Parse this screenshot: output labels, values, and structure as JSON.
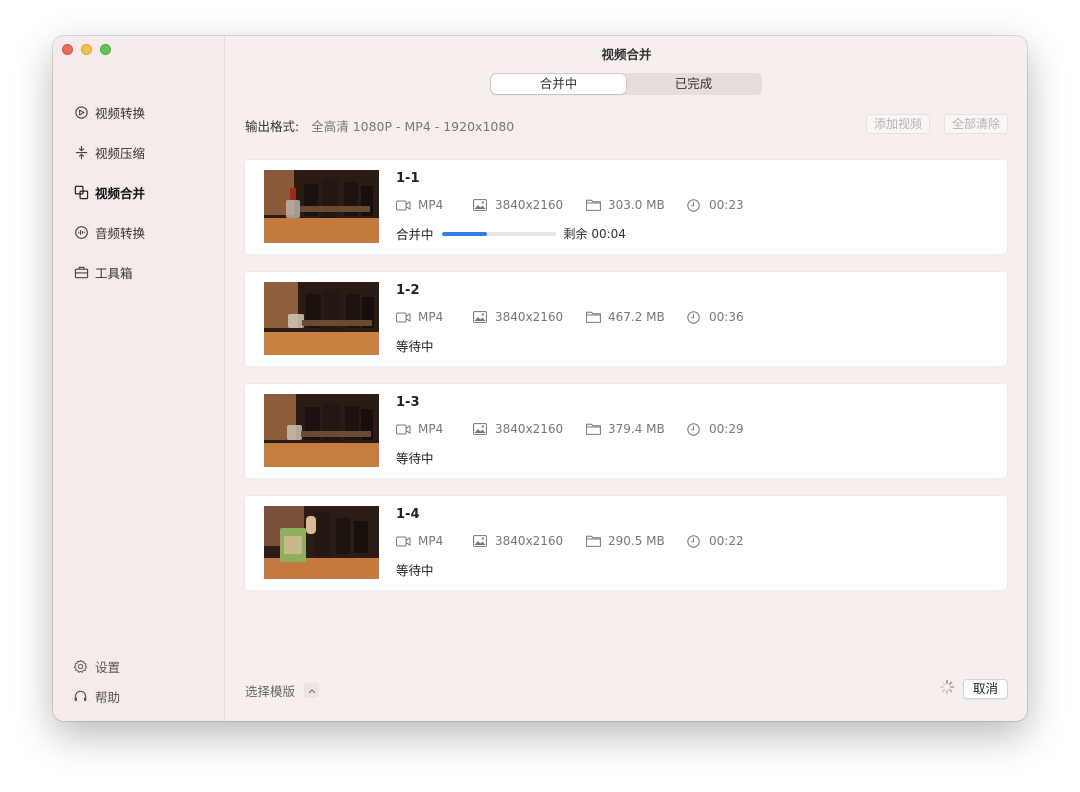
{
  "window": {
    "title": "视频合并"
  },
  "sidebar": {
    "items": [
      {
        "label": "视频转换",
        "icon": "convert-icon",
        "active": false
      },
      {
        "label": "视频压缩",
        "icon": "compress-icon",
        "active": false
      },
      {
        "label": "视频合并",
        "icon": "merge-icon",
        "active": true
      },
      {
        "label": "音频转换",
        "icon": "audio-icon",
        "active": false
      },
      {
        "label": "工具箱",
        "icon": "toolbox-icon",
        "active": false
      }
    ],
    "bottom": [
      {
        "label": "设置",
        "icon": "gear-icon"
      },
      {
        "label": "帮助",
        "icon": "headset-icon"
      }
    ]
  },
  "tabs": [
    {
      "label": "合并中",
      "active": true
    },
    {
      "label": "已完成",
      "active": false
    }
  ],
  "output": {
    "label": "输出格式:",
    "value": "全高清 1080P - MP4 - 1920x1080"
  },
  "actions": {
    "add_video": "添加视频",
    "clear_all": "全部清除"
  },
  "videos": [
    {
      "name": "1-1",
      "format": "MP4",
      "resolution": "3840x2160",
      "size": "303.0 MB",
      "duration": "00:23",
      "status": "合并中",
      "progress": 0.4,
      "remaining": "剩余 00:04"
    },
    {
      "name": "1-2",
      "format": "MP4",
      "resolution": "3840x2160",
      "size": "467.2 MB",
      "duration": "00:36",
      "status": "等待中"
    },
    {
      "name": "1-3",
      "format": "MP4",
      "resolution": "3840x2160",
      "size": "379.4 MB",
      "duration": "00:29",
      "status": "等待中"
    },
    {
      "name": "1-4",
      "format": "MP4",
      "resolution": "3840x2160",
      "size": "290.5 MB",
      "duration": "00:22",
      "status": "等待中"
    }
  ],
  "footer": {
    "template_label": "选择模版",
    "cancel_label": "取消"
  },
  "colors": {
    "accent": "#2f7fe6",
    "window_bg": "#f7efee"
  }
}
